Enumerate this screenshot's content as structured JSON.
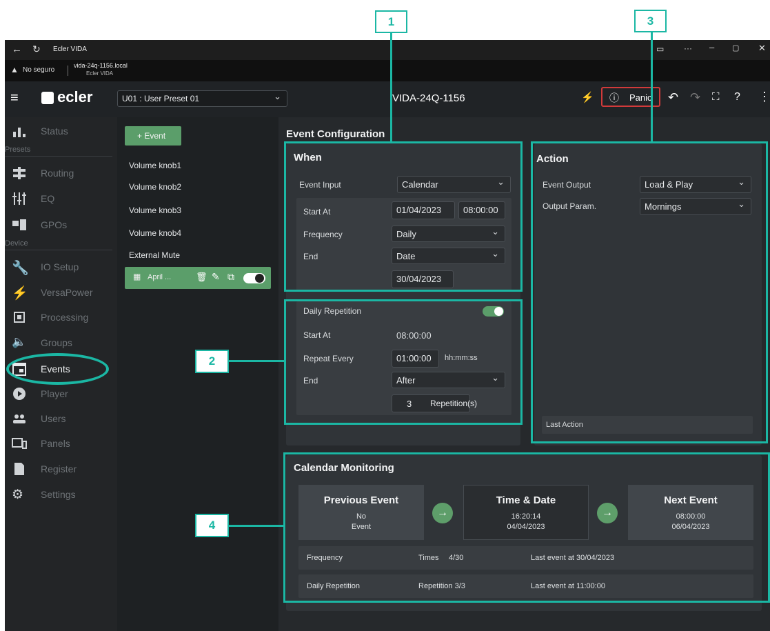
{
  "browser": {
    "title": "Ecler VIDA",
    "security": "No seguro",
    "url": "vida-24q-1156.local",
    "url_sub": "Ecler VIDA"
  },
  "header": {
    "logo": "ecler",
    "preset": "U01 : User Preset 01",
    "device_name": "VIDA-24Q-1156",
    "panic_label": "Panic"
  },
  "sidebar": {
    "items": [
      {
        "label": "Status",
        "icon": "status-icon"
      },
      {
        "label": "Routing",
        "icon": "routing-icon"
      },
      {
        "label": "EQ",
        "icon": "eq-icon"
      },
      {
        "label": "GPOs",
        "icon": "gpos-icon"
      },
      {
        "label": "IO Setup",
        "icon": "wrench-icon"
      },
      {
        "label": "VersaPower",
        "icon": "bolt-icon"
      },
      {
        "label": "Processing",
        "icon": "chip-icon"
      },
      {
        "label": "Groups",
        "icon": "speaker-icon"
      },
      {
        "label": "Events",
        "icon": "calendar-icon"
      },
      {
        "label": "Player",
        "icon": "play-icon"
      },
      {
        "label": "Users",
        "icon": "users-icon"
      },
      {
        "label": "Panels",
        "icon": "panels-icon"
      },
      {
        "label": "Register",
        "icon": "file-icon"
      },
      {
        "label": "Settings",
        "icon": "gear-icon"
      }
    ],
    "sections": {
      "presets": "Presets",
      "device": "Device"
    }
  },
  "events": {
    "add_label": "+ Event",
    "list": [
      "Volume knob1",
      "Volume knob2",
      "Volume knob3",
      "Volume knob4",
      "External Mute"
    ],
    "selected": "April ..."
  },
  "config": {
    "title": "Event Configuration",
    "when": {
      "title": "When",
      "event_input_label": "Event Input",
      "event_input_value": "Calendar",
      "start_at_label": "Start At",
      "start_date": "01/04/2023",
      "start_time": "08:00:00",
      "frequency_label": "Frequency",
      "frequency_value": "Daily",
      "end_label": "End",
      "end_value": "Date",
      "end_date": "30/04/2023"
    },
    "repetition": {
      "title": "Daily Repetition",
      "start_at_label": "Start At",
      "start_at_value": "08:00:00",
      "repeat_label": "Repeat Every",
      "repeat_value": "01:00:00",
      "repeat_unit": "hh:mm:ss",
      "end_label": "End",
      "end_value": "After",
      "count": "3",
      "count_unit": "Repetition(s)"
    },
    "action": {
      "title": "Action",
      "output_label": "Event Output",
      "output_value": "Load & Play",
      "param_label": "Output Param.",
      "param_value": "Mornings",
      "last_action": "Last Action"
    }
  },
  "monitoring": {
    "title": "Calendar Monitoring",
    "previous_title": "Previous Event",
    "previous_line1": "No",
    "previous_line2": "Event",
    "time_title": "Time & Date",
    "time_line1": "16:20:14",
    "time_line2": "04/04/2023",
    "next_title": "Next Event",
    "next_line1": "08:00:00",
    "next_line2": "06/04/2023",
    "row1_label": "Frequency",
    "row1_mid_label": "Times",
    "row1_mid_value": "4/30",
    "row1_last": "Last event at 30/04/2023",
    "row2_label": "Daily Repetition",
    "row2_mid": "Repetition 3/3",
    "row2_last": "Last event at 11:00:00"
  },
  "callouts": [
    "1",
    "2",
    "3",
    "4"
  ],
  "colors": {
    "accent": "#1bb7a4",
    "green": "#5b9e6a",
    "background": "#26292c"
  }
}
